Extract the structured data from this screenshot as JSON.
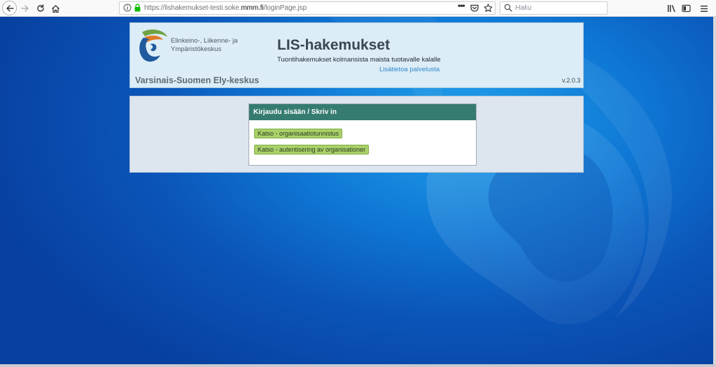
{
  "browser": {
    "url_prefix": "https://lishakemukset-testi.soke.",
    "url_domain": "mmm.fi",
    "url_suffix": "/loginPage.jsp",
    "page_actions": "•••",
    "search_placeholder": "Haku",
    "icons": [
      "back-icon",
      "forward-icon",
      "reload-icon",
      "home-icon",
      "info-icon",
      "lock-icon",
      "pocket-icon",
      "bookmark-star-icon",
      "search-icon",
      "library-icon",
      "sidebar-icon",
      "menu-icon"
    ]
  },
  "header": {
    "logo_text": "Elinkeino-, Liikenne- ja Ympäristökeskus",
    "ely_name": "Varsinais-Suomen Ely-keskus",
    "app_title": "LIS-hakemukset",
    "app_subtitle": "Tuontihakemukset kolmansista maista tuotavalle kalalle",
    "info_link": "Lisätietoa palvelusta",
    "version": "v.2.0.3"
  },
  "login": {
    "title": "Kirjaudu sisään / Skriv in",
    "buttons": [
      {
        "label": "Katso - organisaatiotunnistus"
      },
      {
        "label": "Katso - autentisering av organisationer"
      }
    ]
  },
  "colors": {
    "login_header": "#357b70",
    "button_green": "#a9d16b",
    "link_blue": "#2f87c6",
    "background_blue": "#0b55b8"
  }
}
